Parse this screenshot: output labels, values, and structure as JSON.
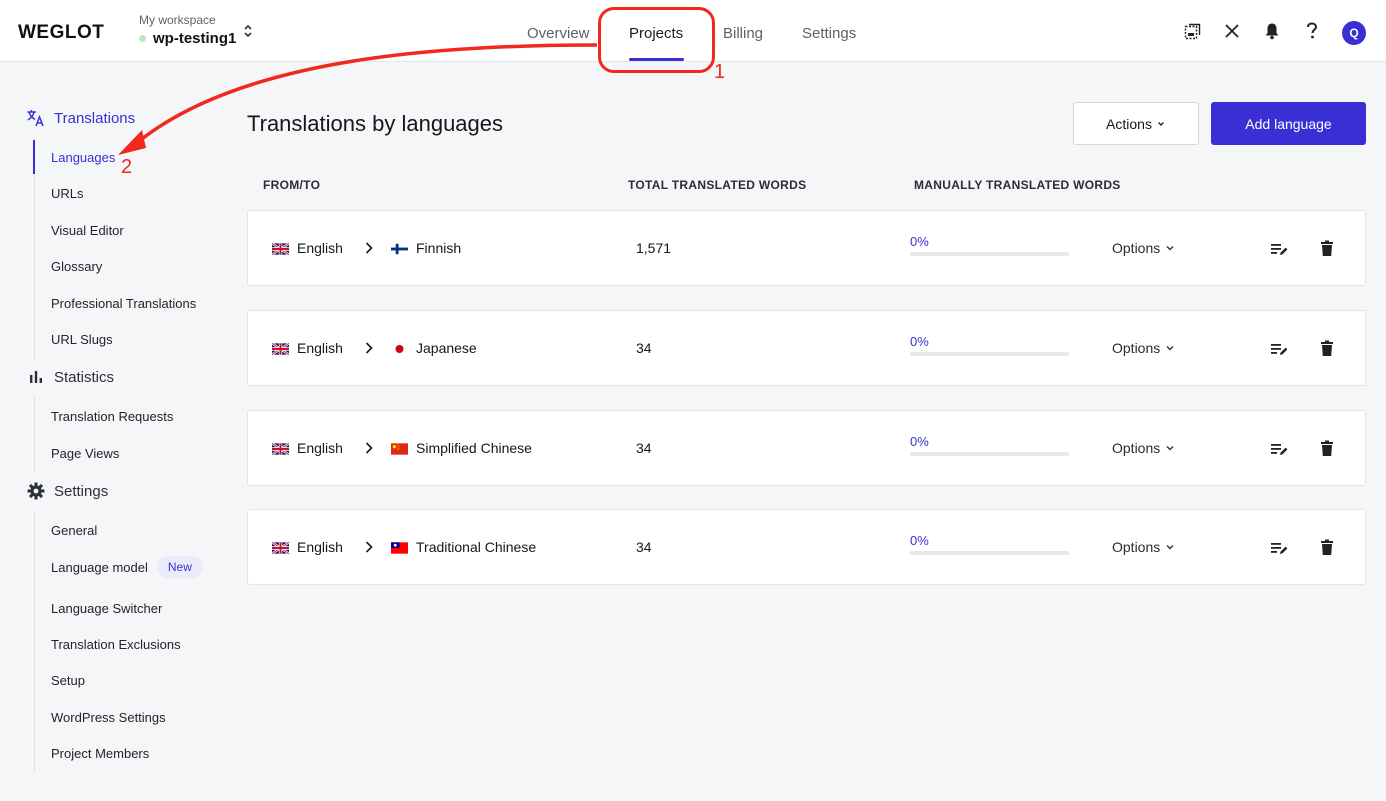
{
  "brand": {
    "logo": "WEGLOT"
  },
  "workspace": {
    "caption": "My workspace",
    "name": "wp-testing1"
  },
  "nav": {
    "overview": "Overview",
    "projects": "Projects",
    "billing": "Billing",
    "settings": "Settings"
  },
  "user": {
    "initial": "Q"
  },
  "annotations": {
    "one": "1",
    "two": "2"
  },
  "sidebar": {
    "translations": {
      "label": "Translations",
      "items": [
        "Languages",
        "URLs",
        "Visual Editor",
        "Glossary",
        "Professional Translations",
        "URL Slugs"
      ]
    },
    "statistics": {
      "label": "Statistics",
      "items": [
        "Translation Requests",
        "Page Views"
      ]
    },
    "settings": {
      "label": "Settings",
      "items": [
        "General",
        "Language model",
        "Language Switcher",
        "Translation Exclusions",
        "Setup",
        "WordPress Settings",
        "Project Members"
      ],
      "new_badge": "New"
    }
  },
  "main": {
    "title": "Translations by languages",
    "actions_label": "Actions",
    "add_language_label": "Add language",
    "columns": {
      "from_to": "FROM/TO",
      "total": "TOTAL TRANSLATED WORDS",
      "manual": "MANUALLY TRANSLATED WORDS"
    },
    "options_label": "Options",
    "rows": [
      {
        "from": "English",
        "to": "Finnish",
        "total": "1,571",
        "manual_pct": "0%",
        "manual_value": 0
      },
      {
        "from": "English",
        "to": "Japanese",
        "total": "34",
        "manual_pct": "0%",
        "manual_value": 0
      },
      {
        "from": "English",
        "to": "Simplified Chinese",
        "total": "34",
        "manual_pct": "0%",
        "manual_value": 0
      },
      {
        "from": "English",
        "to": "Traditional Chinese",
        "total": "34",
        "manual_pct": "0%",
        "manual_value": 0
      }
    ]
  },
  "colors": {
    "accent": "#3a2fd4",
    "annotation": "#f0281e"
  }
}
